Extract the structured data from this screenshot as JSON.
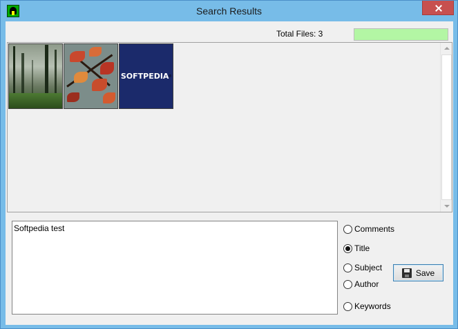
{
  "window": {
    "title": "Search Results"
  },
  "header": {
    "total_files_label": "Total Files: 3",
    "progress_fraction": 1.0,
    "progress_color": "#b3f6a4"
  },
  "thumbnails": [
    {
      "name": "forest-image",
      "icon": "forest-photo"
    },
    {
      "name": "autumn-leaves-image",
      "icon": "leaves-photo"
    },
    {
      "name": "softpedia-logo-image",
      "icon": "softpedia-logo",
      "logo_text": "SOFTPEDIA"
    }
  ],
  "editor": {
    "text": "Softpedia test"
  },
  "fields": {
    "comments": "Comments",
    "title": "Title",
    "subject": "Subject",
    "author": "Author",
    "keywords": "Keywords",
    "selected": "title"
  },
  "buttons": {
    "save_label": "Save",
    "save_icon": "floppy-disk-icon"
  },
  "colors": {
    "titlebar": "#77bce8",
    "close_button": "#c7504f",
    "logo_background": "#1b2a6b"
  }
}
